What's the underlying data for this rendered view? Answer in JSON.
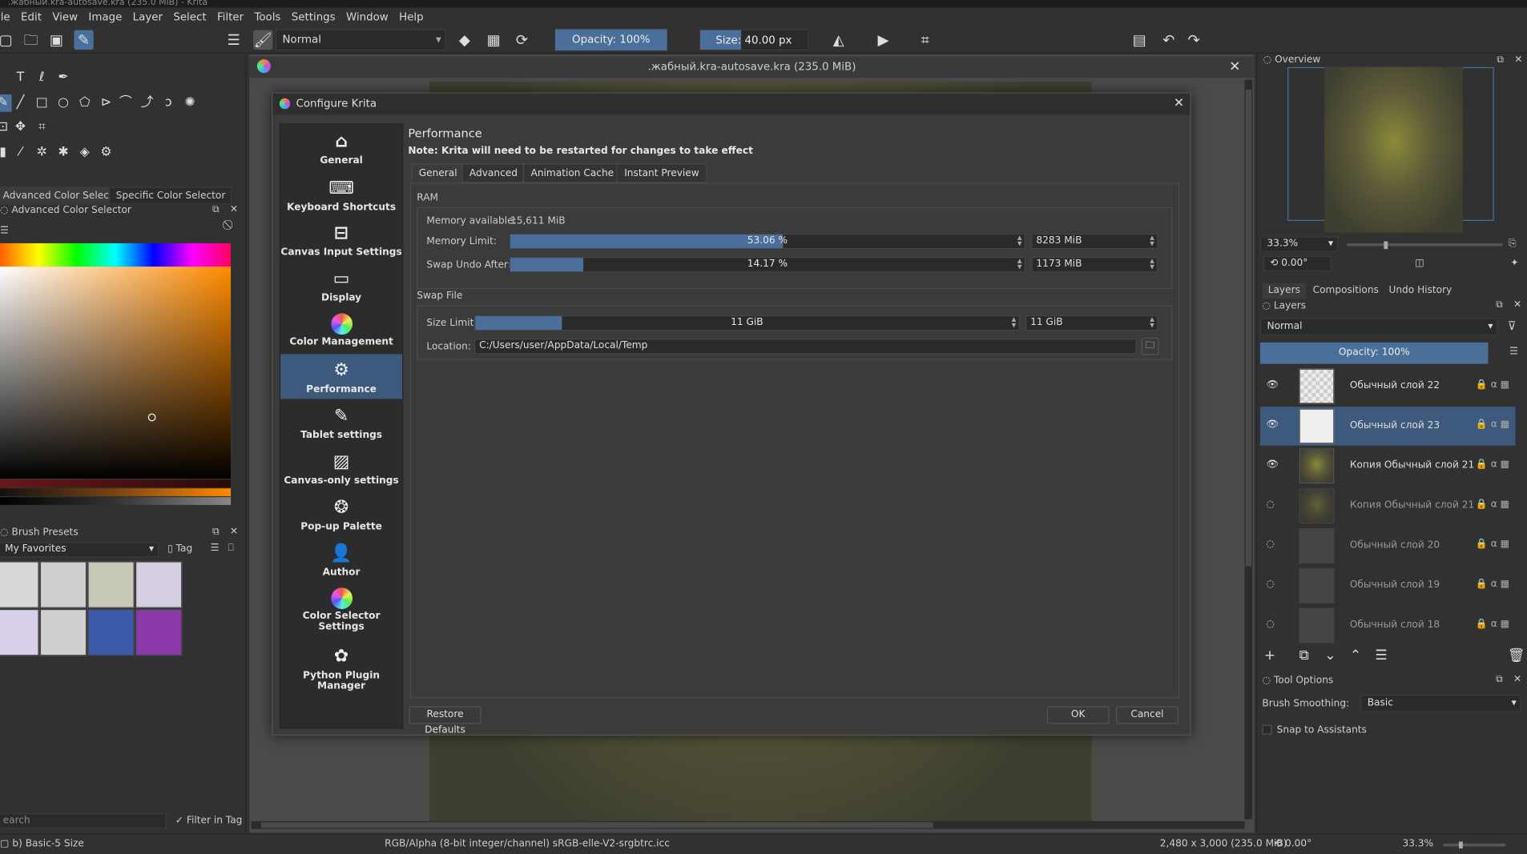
{
  "window": {
    "title": ".жабный.kra-autosave.kra (235.0 MiB) - Krita"
  },
  "menu": [
    "File",
    "Edit",
    "View",
    "Image",
    "Layer",
    "Select",
    "Filter",
    "Tools",
    "Settings",
    "Window",
    "Help"
  ],
  "toolbar": {
    "blend_mode": "Normal",
    "opacity": "Opacity: 100%",
    "size": "Size: 40.00 px"
  },
  "left": {
    "tab_advanced": "Advanced Color Selector",
    "tab_specific": "Specific Color Selector",
    "docker_title": "Advanced Color Selector",
    "brush_presets_title": "Brush Presets",
    "brush_tag": "My Favorites",
    "tag_label": "Tag",
    "search_placeholder": "earch",
    "filter_in_tag": "Filter in Tag"
  },
  "document": {
    "title": ".жабный.kra-autosave.kra (235.0 MiB)"
  },
  "dialog": {
    "title": "Configure Krita",
    "heading": "Performance",
    "note": "Note: Krita will need to be restarted for changes to take effect",
    "nav": [
      "General",
      "Keyboard Shortcuts",
      "Canvas Input Settings",
      "Display",
      "Color Management",
      "Performance",
      "Tablet settings",
      "Canvas-only settings",
      "Pop-up Palette",
      "Author",
      "Color Selector Settings",
      "Python Plugin Manager"
    ],
    "tabs": [
      "General",
      "Advanced",
      "Animation Cache",
      "Instant Preview"
    ],
    "ram_label": "RAM",
    "memory_available_label": "Memory available:",
    "memory_available_value": "15,611 MiB",
    "memory_limit_label": "Memory Limit:",
    "memory_limit_pct": "53.06 %",
    "memory_limit_fraction": 0.5306,
    "memory_limit_mib": "8283 MiB",
    "swap_undo_label": "Swap Undo After:",
    "swap_undo_pct": "14.17 %",
    "swap_undo_fraction": 0.1417,
    "swap_undo_mib": "1173 MiB",
    "swap_file_label": "Swap File",
    "size_limit_label": "Size Limit:",
    "size_limit_value": "11 GiB",
    "size_limit_fraction": 0.16,
    "size_limit_spin": "11 GiB",
    "location_label": "Location:",
    "location_value": "C:/Users/user/AppData/Local/Temp",
    "restore_defaults": "Restore Defaults",
    "ok": "OK",
    "cancel": "Cancel"
  },
  "right": {
    "overview_title": "Overview",
    "zoom": "33.3%",
    "rotation": "0.00°",
    "tabs": [
      "Layers",
      "Compositions",
      "Undo History"
    ],
    "layers_title": "Layers",
    "blend_mode": "Normal",
    "opacity": "Opacity:  100%",
    "layers": [
      {
        "name": "Обычный слой 22",
        "visible": true,
        "selected": false,
        "thumb": "checker"
      },
      {
        "name": "Обычный слой 23",
        "visible": true,
        "selected": true,
        "thumb": "sketch"
      },
      {
        "name": "Копия Обычный слой 21",
        "visible": true,
        "selected": false,
        "thumb": "painting"
      },
      {
        "name": "Копия Обычный слой 21",
        "visible": false,
        "selected": false,
        "thumb": "painting"
      },
      {
        "name": "Обычный слой 20",
        "visible": false,
        "selected": false,
        "thumb": "grey"
      },
      {
        "name": "Обычный слой 19",
        "visible": false,
        "selected": false,
        "thumb": "grey"
      },
      {
        "name": "Обычный слой 18",
        "visible": false,
        "selected": false,
        "thumb": "grey"
      }
    ],
    "tool_options_title": "Tool Options",
    "brush_smoothing_label": "Brush Smoothing:",
    "brush_smoothing_value": "Basic",
    "snap_label": "Snap to Assistants"
  },
  "status": {
    "brush": "b) Basic-5 Size",
    "color": "RGB/Alpha (8-bit integer/channel)  sRGB-elle-V2-srgbtrc.icc",
    "dimensions": "2,480 x 3,000 (235.0 MiB)",
    "rotation": "0.00°",
    "zoom": "33.3%"
  },
  "colors": {
    "accent": "#4a6f9a",
    "selection": "#3d5a7c",
    "background": "#313131"
  }
}
